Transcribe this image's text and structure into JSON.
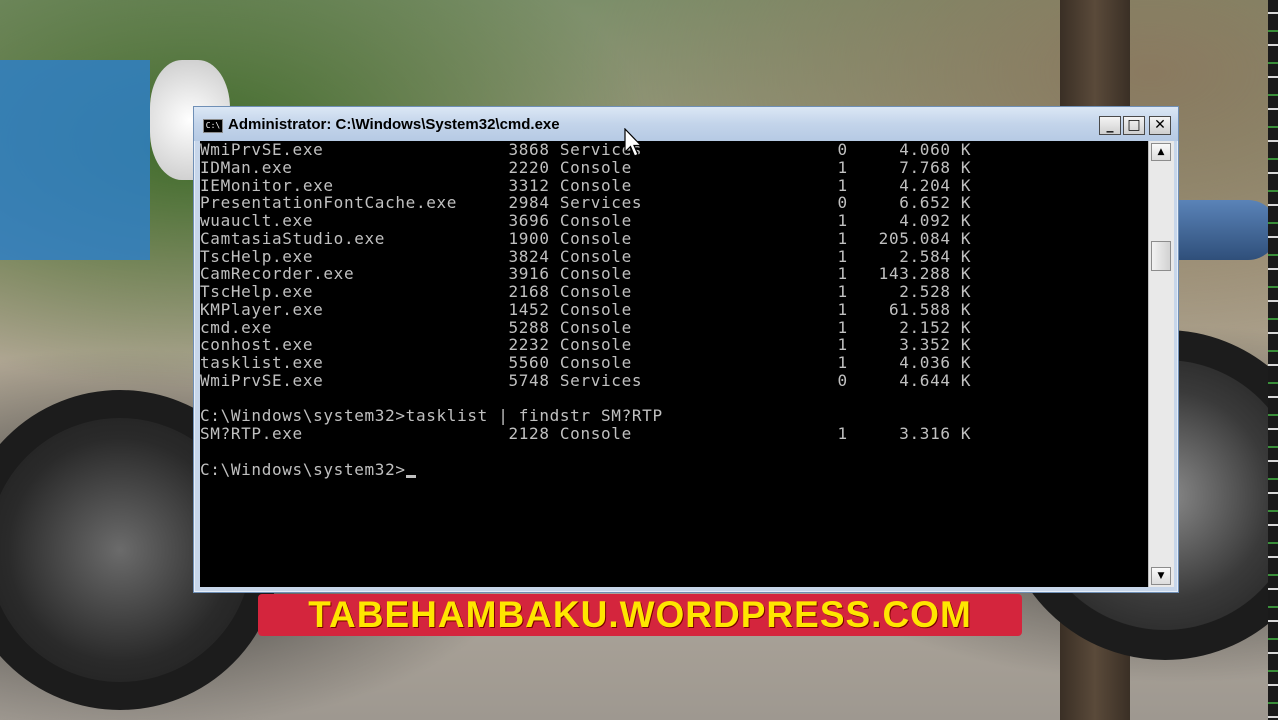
{
  "window": {
    "title": "Administrator: C:\\Windows\\System32\\cmd.exe",
    "icon_name": "cmd-app-icon",
    "icon_glyph": "C:\\",
    "controls": {
      "minimize": "_",
      "maximize": "□",
      "close": "✕"
    }
  },
  "console": {
    "text_color": "#c0c0c0",
    "background": "#000000",
    "rows": [
      {
        "image": "WmiPrvSE.exe",
        "pid": "3868",
        "session": "Services",
        "num": "0",
        "mem": "4.060 K"
      },
      {
        "image": "IDMan.exe",
        "pid": "2220",
        "session": "Console",
        "num": "1",
        "mem": "7.768 K"
      },
      {
        "image": "IEMonitor.exe",
        "pid": "3312",
        "session": "Console",
        "num": "1",
        "mem": "4.204 K"
      },
      {
        "image": "PresentationFontCache.exe",
        "pid": "2984",
        "session": "Services",
        "num": "0",
        "mem": "6.652 K"
      },
      {
        "image": "wuauclt.exe",
        "pid": "3696",
        "session": "Console",
        "num": "1",
        "mem": "4.092 K"
      },
      {
        "image": "CamtasiaStudio.exe",
        "pid": "1900",
        "session": "Console",
        "num": "1",
        "mem": "205.084 K"
      },
      {
        "image": "TscHelp.exe",
        "pid": "3824",
        "session": "Console",
        "num": "1",
        "mem": "2.584 K"
      },
      {
        "image": "CamRecorder.exe",
        "pid": "3916",
        "session": "Console",
        "num": "1",
        "mem": "143.288 K"
      },
      {
        "image": "TscHelp.exe",
        "pid": "2168",
        "session": "Console",
        "num": "1",
        "mem": "2.528 K"
      },
      {
        "image": "KMPlayer.exe",
        "pid": "1452",
        "session": "Console",
        "num": "1",
        "mem": "61.588 K"
      },
      {
        "image": "cmd.exe",
        "pid": "5288",
        "session": "Console",
        "num": "1",
        "mem": "2.152 K"
      },
      {
        "image": "conhost.exe",
        "pid": "2232",
        "session": "Console",
        "num": "1",
        "mem": "3.352 K"
      },
      {
        "image": "tasklist.exe",
        "pid": "5560",
        "session": "Console",
        "num": "1",
        "mem": "4.036 K"
      },
      {
        "image": "WmiPrvSE.exe",
        "pid": "5748",
        "session": "Services",
        "num": "0",
        "mem": "4.644 K"
      }
    ],
    "command_line": "C:\\Windows\\system32>tasklist | findstr SM?RTP",
    "result_rows": [
      {
        "image": "SM?RTP.exe",
        "pid": "2128",
        "session": "Console",
        "num": "1",
        "mem": "3.316 K"
      }
    ],
    "prompt": "C:\\Windows\\system32>"
  },
  "scrollbar": {
    "up_arrow": "▲",
    "down_arrow": "▼"
  },
  "banner": {
    "text": "TABEHAMBAKU.WORDPRESS.COM",
    "background": "#d4253d",
    "color": "#ffe600"
  }
}
